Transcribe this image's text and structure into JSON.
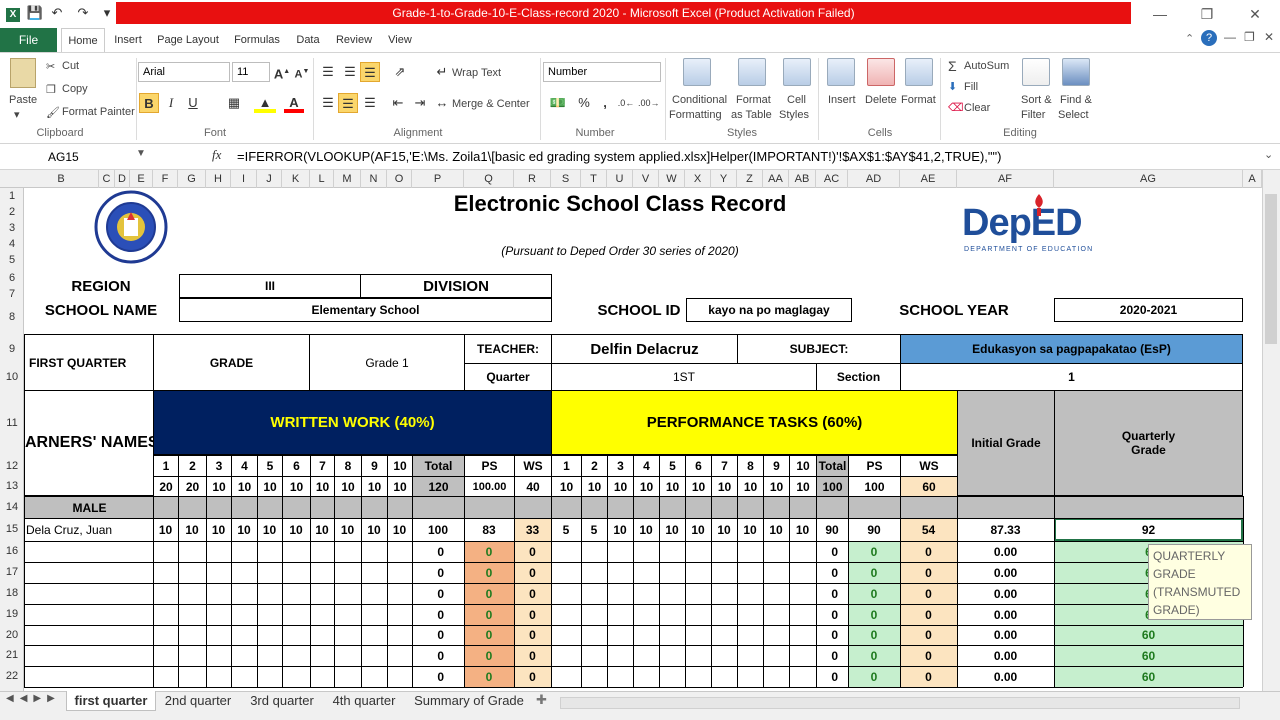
{
  "window": {
    "title": "Grade-1-to-Grade-10-E-Class-record 2020 - Microsoft Excel (Product Activation Failed)"
  },
  "ribbon_tabs": [
    "File",
    "Home",
    "Insert",
    "Page Layout",
    "Formulas",
    "Data",
    "Review",
    "View"
  ],
  "ribbon": {
    "clipboard": {
      "paste": "Paste",
      "cut": "Cut",
      "copy": "Copy",
      "format_painter": "Format Painter",
      "label": "Clipboard"
    },
    "font": {
      "name": "Arial",
      "size": "11",
      "label": "Font"
    },
    "alignment": {
      "wrap": "Wrap Text",
      "merge": "Merge & Center",
      "label": "Alignment"
    },
    "number": {
      "format": "Number",
      "label": "Number",
      "percent": "%",
      "comma": ","
    },
    "styles": {
      "cond": "Conditional",
      "cond2": "Formatting",
      "fmt_table": "Format",
      "fmt_table2": "as Table",
      "cell_styles": "Cell",
      "cell_styles2": "Styles",
      "label": "Styles"
    },
    "cells": {
      "insert": "Insert",
      "delete": "Delete",
      "format": "Format",
      "label": "Cells"
    },
    "editing": {
      "autosum": "AutoSum",
      "fill": "Fill",
      "clear": "Clear",
      "sort": "Sort &",
      "sort2": "Filter",
      "find": "Find &",
      "find2": "Select",
      "label": "Editing"
    }
  },
  "formula_bar": {
    "name_box": "AG15",
    "fx": "fx",
    "formula": "=IFERROR(VLOOKUP(AF15,'E:\\Ms. Zoila1\\[basic ed grading system applied.xlsx]Helper(IMPORTANT!)'!$AX$1:$AY$41,2,TRUE),\"\")"
  },
  "columns": [
    "B",
    "C",
    "D",
    "E",
    "F",
    "G",
    "H",
    "I",
    "J",
    "K",
    "L",
    "M",
    "N",
    "O",
    "P",
    "Q",
    "R",
    "S",
    "T",
    "U",
    "V",
    "W",
    "X",
    "Y",
    "Z",
    "AA",
    "AB",
    "AC",
    "AD",
    "AE",
    "AF",
    "AG",
    "A"
  ],
  "rows": [
    "1",
    "2",
    "3",
    "4",
    "5",
    "6",
    "7",
    "8",
    "9",
    "10",
    "11",
    "12",
    "13",
    "14",
    "15",
    "16",
    "17",
    "18",
    "19",
    "20",
    "21",
    "22"
  ],
  "sheet": {
    "title": "Electronic School Class Record",
    "subtitle": "(Pursuant to Deped Order 30  series of 2020)",
    "deped_logo": "DepED",
    "deped_sub": "DEPARTMENT OF EDUCATION",
    "region_label": "REGION",
    "region_value": "III",
    "division_label": "DIVISION",
    "school_name_label": "SCHOOL NAME",
    "school_name_value": "Elementary School",
    "school_id_label": "SCHOOL ID",
    "school_id_value": "kayo na po maglagay",
    "school_year_label": "SCHOOL YEAR",
    "school_year_value": "2020-2021",
    "quarter_label": "FIRST QUARTER",
    "grade_label": "GRADE",
    "grade_value": "Grade 1",
    "teacher_label": "TEACHER:",
    "teacher_value": "Delfin Delacruz",
    "subject_label": "SUBJECT:",
    "subject_value": "Edukasyon sa pagpapakatao (EsP)",
    "quarter_field_label": "Quarter",
    "quarter_field_value": "1ST",
    "section_label": "Section",
    "section_value": "1",
    "learners_label": "ARNERS' NAMES",
    "written_work": "WRITTEN WORK (40%)",
    "performance_tasks": "PERFORMANCE TASKS (60%)",
    "initial_grade": "Initial Grade",
    "quarterly_grade": "Quarterly Grade",
    "item_numbers": [
      "1",
      "2",
      "3",
      "4",
      "5",
      "6",
      "7",
      "8",
      "9",
      "10"
    ],
    "total_label": "Total",
    "ps_label": "PS",
    "ws_label": "WS",
    "ww_hps": [
      "20",
      "20",
      "10",
      "10",
      "10",
      "10",
      "10",
      "10",
      "10",
      "10"
    ],
    "ww_hps_total": "120",
    "ww_hps_ps": "100.00",
    "ww_hps_ws": "40",
    "pt_hps": [
      "10",
      "10",
      "10",
      "10",
      "10",
      "10",
      "10",
      "10",
      "10",
      "10"
    ],
    "pt_hps_total": "100",
    "pt_hps_ps": "100",
    "pt_hps_ws": "60",
    "male_label": "MALE",
    "student": {
      "name": "Dela Cruz, Juan",
      "ww": [
        "10",
        "10",
        "10",
        "10",
        "10",
        "10",
        "10",
        "10",
        "10",
        "10"
      ],
      "ww_total": "100",
      "ww_ps": "83",
      "ww_ws": "33",
      "pt": [
        "5",
        "5",
        "10",
        "10",
        "10",
        "10",
        "10",
        "10",
        "10",
        "10"
      ],
      "pt_total": "90",
      "pt_ps": "90",
      "pt_ws": "54",
      "initial": "87.33",
      "quarterly": "92"
    },
    "empty_rows": [
      {
        "ww_total": "0",
        "ww_ps": "0",
        "ww_ws": "0",
        "pt_total": "0",
        "pt_ps": "0",
        "pt_ws": "0",
        "initial": "0.00",
        "quarterly": "6"
      },
      {
        "ww_total": "0",
        "ww_ps": "0",
        "ww_ws": "0",
        "pt_total": "0",
        "pt_ps": "0",
        "pt_ws": "0",
        "initial": "0.00",
        "quarterly": "6"
      },
      {
        "ww_total": "0",
        "ww_ps": "0",
        "ww_ws": "0",
        "pt_total": "0",
        "pt_ps": "0",
        "pt_ws": "0",
        "initial": "0.00",
        "quarterly": "6"
      },
      {
        "ww_total": "0",
        "ww_ps": "0",
        "ww_ws": "0",
        "pt_total": "0",
        "pt_ps": "0",
        "pt_ws": "0",
        "initial": "0.00",
        "quarterly": "6"
      },
      {
        "ww_total": "0",
        "ww_ps": "0",
        "ww_ws": "0",
        "pt_total": "0",
        "pt_ps": "0",
        "pt_ws": "0",
        "initial": "0.00",
        "quarterly": "60"
      },
      {
        "ww_total": "0",
        "ww_ps": "0",
        "ww_ws": "0",
        "pt_total": "0",
        "pt_ps": "0",
        "pt_ws": "0",
        "initial": "0.00",
        "quarterly": "60"
      },
      {
        "ww_total": "0",
        "ww_ps": "0",
        "ww_ws": "0",
        "pt_total": "0",
        "pt_ps": "0",
        "pt_ws": "0",
        "initial": "0.00",
        "quarterly": "60"
      }
    ],
    "tooltip": [
      "QUARTERLY",
      "GRADE",
      "(TRANSMUTED",
      "GRADE)"
    ]
  },
  "sheet_tabs": [
    "first quarter",
    "2nd quarter",
    "3rd quarter",
    "4th quarter",
    "Summary of Grade"
  ],
  "colors": {
    "excel_green": "#217346",
    "title_red": "#e81010",
    "written_blue": "#002060",
    "performance_yellow": "#ffff00",
    "gray_header": "#bfbfbf",
    "ps_orange": "#f4b183",
    "ws_beige": "#fce4c0",
    "green_fill": "#c6efce",
    "subject_blue": "#5b9bd5"
  }
}
